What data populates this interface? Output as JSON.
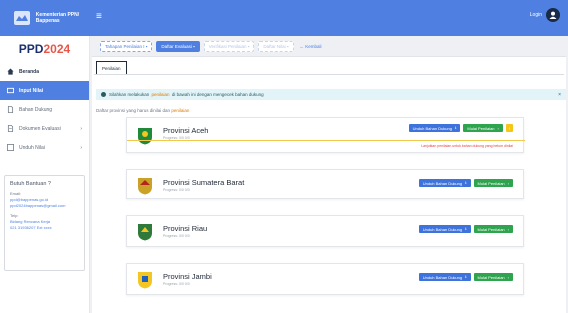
{
  "brand": {
    "text": "Kementerian PPN/ Bappenas"
  },
  "topbar": {
    "menu_icon": "hamburger-icon",
    "user_label": "Login"
  },
  "sidebar": {
    "title_main": "PPD",
    "title_year": "2024",
    "items": [
      {
        "label": "Beranda",
        "icon": "home-icon"
      },
      {
        "label": "Input Nilai",
        "icon": "input-icon"
      },
      {
        "label": "Bahan Dukung",
        "icon": "file-icon"
      },
      {
        "label": "Dokumen Evaluasi",
        "icon": "doc-icon"
      },
      {
        "label": "Unduh Nilai",
        "icon": "download-icon"
      }
    ],
    "help": {
      "title": "Butuh Bantuan ?",
      "email_label": "Email:",
      "email_1": "ppd@bappenas.go.id",
      "email_2": "ppd2024bappenas@gmail.com",
      "phone_label": "Telp:",
      "phone_1": "Bidang Rencana Kerja",
      "phone_2": "021 31936207 Ext xxxx"
    }
  },
  "breadcrumb": [
    {
      "label": "Tahapan Penilaian I",
      "state": "done"
    },
    {
      "label": "Daftar Evaluasi",
      "state": "current"
    },
    {
      "label": "Verifikasi Penilaian",
      "state": "disabled"
    },
    {
      "label": "Daftar Nilai",
      "state": "disabled"
    },
    {
      "label": "Kembali",
      "state": "link"
    }
  ],
  "tab": {
    "label": "Penilaian"
  },
  "alert": {
    "pre": "Silahkan melakukan",
    "hl": "penilaian",
    "post": "di bawah ini dengan mengecek bahan dukung"
  },
  "hint": {
    "pre": "Daftar provinsi yang harus dinilai dan",
    "hl": "penilaian"
  },
  "provinces": [
    {
      "name": "Provinsi Aceh",
      "progress": "Progress: 0/0 0/0",
      "buttons": [
        "Unduh Bahan Dukung",
        "Mulai Penilaian"
      ],
      "warning": true,
      "note": "Lanjutkan penilaian untuk bahan dukung yang belum dinilai"
    },
    {
      "name": "Provinsi Sumatera Barat",
      "progress": "Progress: 0/0 0/0",
      "buttons": [
        "Unduh Bahan Dukung",
        "Mulai Penilaian"
      ],
      "warning": false,
      "note": ""
    },
    {
      "name": "Provinsi Riau",
      "progress": "Progress: 0/0 0/0",
      "buttons": [
        "Unduh Bahan Dukung",
        "Mulai Penilaian"
      ],
      "warning": false,
      "note": ""
    },
    {
      "name": "Provinsi Jambi",
      "progress": "Progress: 0/0 0/0",
      "buttons": [
        "Unduh Bahan Dukung",
        "Mulai Penilaian"
      ],
      "warning": false,
      "note": ""
    }
  ],
  "colors": {
    "primary": "#4f80e1",
    "success": "#2ea44f",
    "warning": "#f5c518",
    "danger": "#e1424a"
  }
}
